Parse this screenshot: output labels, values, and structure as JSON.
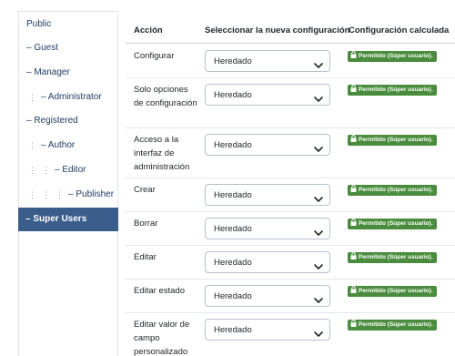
{
  "groups": [
    {
      "label": "Public",
      "depth": 0,
      "active": false
    },
    {
      "label": "– Guest",
      "depth": 0,
      "active": false
    },
    {
      "label": "– Manager",
      "depth": 0,
      "active": false
    },
    {
      "label": "– Administrator",
      "depth": 1,
      "active": false
    },
    {
      "label": "– Registered",
      "depth": 0,
      "active": false
    },
    {
      "label": "– Author",
      "depth": 1,
      "active": false
    },
    {
      "label": "– Editor",
      "depth": 2,
      "active": false
    },
    {
      "label": "– Publisher",
      "depth": 3,
      "active": false
    },
    {
      "label": "– Super Users",
      "depth": 0,
      "active": true
    }
  ],
  "table": {
    "col_action": "Acción",
    "col_new_setting": "Seleccionar la nueva configuración",
    "col_calculated": "Configuración calculada"
  },
  "rows": [
    {
      "action": "Configurar",
      "setting": "Heredado",
      "calculated": "Permitido (Súper usuario)."
    },
    {
      "action": "Solo opciones de configuración",
      "setting": "Heredado",
      "calculated": "Permitido (Súper usuario)."
    },
    {
      "action": "Acceso a la interfaz de administración",
      "setting": "Heredado",
      "calculated": "Permitido (Súper usuario)."
    },
    {
      "action": "Crear",
      "setting": "Heredado",
      "calculated": "Permitido (Súper usuario)."
    },
    {
      "action": "Borrar",
      "setting": "Heredado",
      "calculated": "Permitido (Súper usuario)."
    },
    {
      "action": "Editar",
      "setting": "Heredado",
      "calculated": "Permitido (Súper usuario)."
    },
    {
      "action": "Editar estado",
      "setting": "Heredado",
      "calculated": "Permitido (Súper usuario)."
    },
    {
      "action": "Editar valor de campo personalizado",
      "setting": "Heredado",
      "calculated": "Permitido (Súper usuario)."
    }
  ],
  "icons": {
    "select_chevron": "chevron-down-icon",
    "badge": "lock-icon",
    "tree_indent": "vertical-dots"
  },
  "colors": {
    "active_group_bg": "#3a5d8b",
    "badge_bg": "#4a8c3d",
    "link_text": "#1f3c64"
  }
}
